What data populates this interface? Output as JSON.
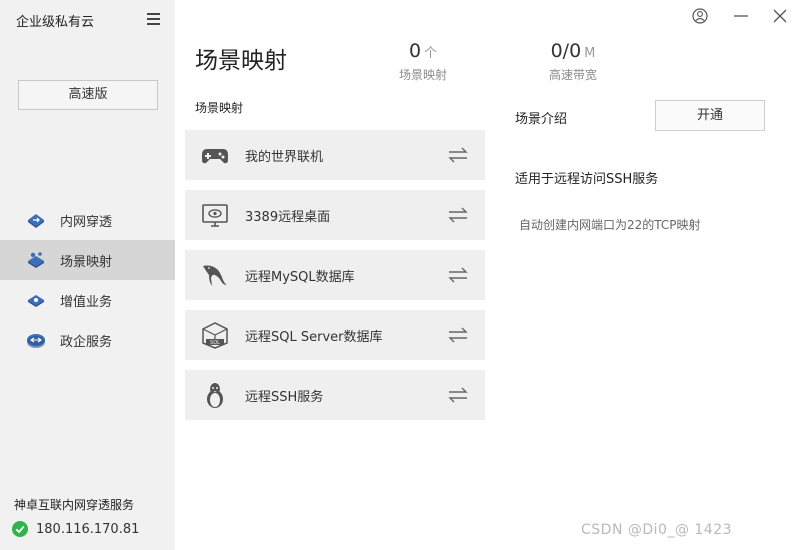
{
  "app": {
    "title": "企业级私有云"
  },
  "sidebar": {
    "edition_button": "高速版",
    "items": [
      {
        "label": "内网穿透",
        "icon": "tunnel-icon",
        "active": false
      },
      {
        "label": "场景映射",
        "icon": "scene-map-icon",
        "active": true
      },
      {
        "label": "增值业务",
        "icon": "value-service-icon",
        "active": false
      },
      {
        "label": "政企服务",
        "icon": "gov-service-icon",
        "active": false
      }
    ],
    "footer": {
      "title": "神卓互联内网穿透服务",
      "ip": "180.116.170.81",
      "status_icon": "check-circle-icon",
      "status_color": "#2fb34a"
    }
  },
  "window_controls": [
    "user-icon",
    "minimize-icon",
    "close-icon"
  ],
  "header": {
    "title": "场景映射",
    "stats": [
      {
        "value": "0",
        "unit": "个",
        "caption": "场景映射"
      },
      {
        "value": "0/0",
        "unit": "M",
        "caption": "高速带宽"
      }
    ]
  },
  "scenes": {
    "section_label": "场景映射",
    "items": [
      {
        "label": "我的世界联机",
        "icon": "gamepad-icon"
      },
      {
        "label": "3389远程桌面",
        "icon": "monitor-icon"
      },
      {
        "label": "远程MySQL数据库",
        "icon": "mysql-dolphin-icon"
      },
      {
        "label": "远程SQL Server数据库",
        "icon": "sql-server-icon"
      },
      {
        "label": "远程SSH服务",
        "icon": "linux-penguin-icon"
      }
    ]
  },
  "detail": {
    "intro_label": "场景介绍",
    "open_button": "开通",
    "title": "适用于远程访问SSH服务",
    "description": "自动创建内网端口为22的TCP映射"
  },
  "watermark": "CSDN @Di0_@ 1423",
  "colors": {
    "sidebar_bg": "#f1f1f1",
    "active_bg": "#d6d6d6",
    "nav_icon_blue": "#3d6fb8",
    "card_bg": "#efefef"
  }
}
